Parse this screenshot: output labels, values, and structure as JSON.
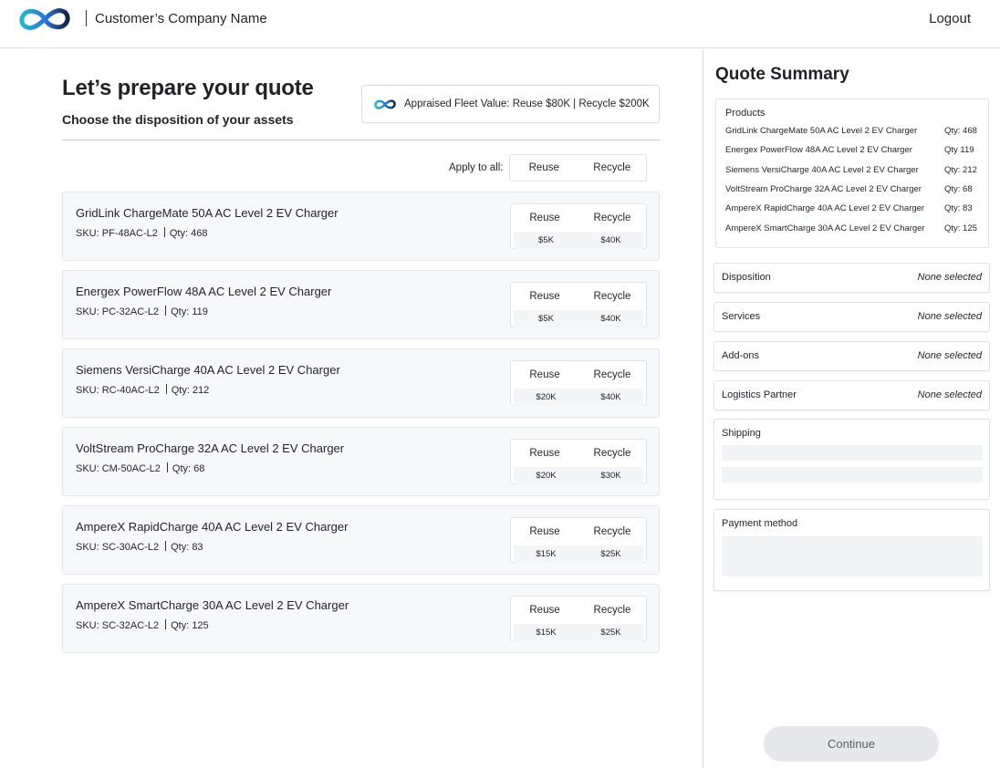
{
  "header": {
    "company_name": "Customer’s Company Name",
    "logout_label": "Logout",
    "logo_icon": "infinity-logo-icon",
    "brand_colors": {
      "teal": "#22b8cf",
      "blue": "#2b6fd6",
      "navy": "#12233f"
    }
  },
  "main": {
    "title": "Let’s prepare your quote",
    "subtitle": "Choose the disposition of your assets",
    "fleet_value_text": "Appraised Fleet Value: Reuse $80K | Recycle $200K",
    "apply_all": {
      "label": "Apply to all:",
      "reuse": "Reuse",
      "recycle": "Recycle"
    },
    "products": [
      {
        "name": "GridLink ChargeMate 50A AC Level 2 EV Charger",
        "sku": "SKU: PF-48AC-L2",
        "qty": "Qty: 468",
        "reuse_label": "Reuse",
        "recycle_label": "Recycle",
        "reuse_price": "$5K",
        "recycle_price": "$40K"
      },
      {
        "name": "Energex PowerFlow 48A AC Level 2 EV Charger",
        "sku": "SKU: PC-32AC-L2",
        "qty": "Qty: 119",
        "reuse_label": "Reuse",
        "recycle_label": "Recycle",
        "reuse_price": "$5K",
        "recycle_price": "$40K"
      },
      {
        "name": "Siemens VersiCharge 40A AC Level 2 EV Charger",
        "sku": "SKU: RC-40AC-L2",
        "qty": "Qty: 212",
        "reuse_label": "Reuse",
        "recycle_label": "Recycle",
        "reuse_price": "$20K",
        "recycle_price": "$40K"
      },
      {
        "name": "VoltStream ProCharge 32A AC Level 2 EV Charger",
        "sku": "SKU: CM-50AC-L2",
        "qty": "Qty: 68",
        "reuse_label": "Reuse",
        "recycle_label": "Recycle",
        "reuse_price": "$20K",
        "recycle_price": "$30K"
      },
      {
        "name": "AmpereX RapidCharge 40A AC Level 2 EV Charger",
        "sku": "SKU: SC-30AC-L2",
        "qty": "Qty: 83",
        "reuse_label": "Reuse",
        "recycle_label": "Recycle",
        "reuse_price": "$15K",
        "recycle_price": "$25K"
      },
      {
        "name": "AmpereX SmartCharge 30A AC Level 2 EV Charger",
        "sku": "SKU: SC-32AC-L2",
        "qty": "Qty: 125",
        "reuse_label": "Reuse",
        "recycle_label": "Recycle",
        "reuse_price": "$15K",
        "recycle_price": "$25K"
      }
    ]
  },
  "summary": {
    "title": "Quote Summary",
    "products_label": "Products",
    "products": [
      {
        "name": "GridLink ChargeMate 50A AC Level 2 EV Charger",
        "qty": "Qty: 468"
      },
      {
        "name": "Energex PowerFlow 48A AC Level 2 EV Charger",
        "qty": "Qty 119"
      },
      {
        "name": "Siemens VersiCharge 40A AC Level 2 EV Charger",
        "qty": "Qty: 212"
      },
      {
        "name": "VoltStream ProCharge 32A AC Level 2 EV Charger",
        "qty": "Qty: 68"
      },
      {
        "name": "AmpereX RapidCharge 40A AC Level 2 EV Charger",
        "qty": "Qty: 83"
      },
      {
        "name": "AmpereX SmartCharge 30A AC Level 2 EV Charger",
        "qty": "Qty: 125"
      }
    ],
    "selectors": [
      {
        "label": "Disposition",
        "value": "None selected"
      },
      {
        "label": "Services",
        "value": "None selected"
      },
      {
        "label": "Add-ons",
        "value": "None selected"
      },
      {
        "label": "Logistics Partner",
        "value": "None selected"
      }
    ],
    "shipping_label": "Shipping",
    "payment_label": "Payment method",
    "continue_label": "Continue"
  }
}
